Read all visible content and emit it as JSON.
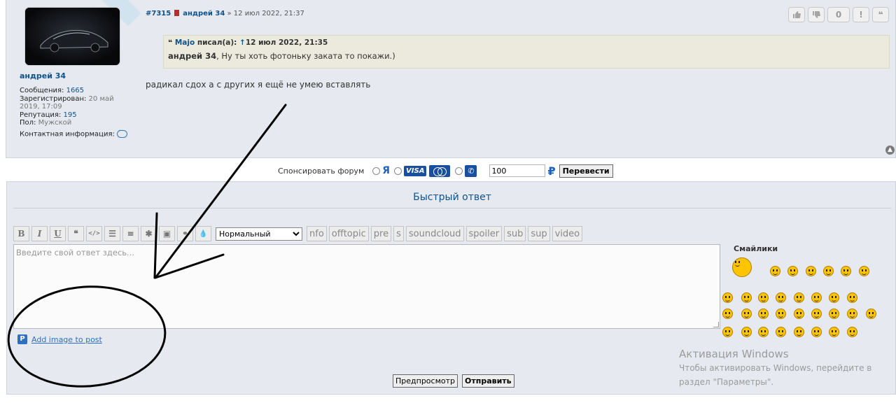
{
  "post": {
    "author": "андрей 34",
    "profile": {
      "messages_label": "Сообщения:",
      "messages": "1665",
      "registered_label": "Зарегистрирован:",
      "registered": "20 май",
      "registered2": "2019, 17:09",
      "reputation_label": "Репутация:",
      "reputation": "195",
      "gender_label": "Пол:",
      "gender": "Мужской",
      "contact_label": "Контактная информация:"
    },
    "number": "#7315",
    "header_author": "андрей 34",
    "separator": "»",
    "date": "12 июл 2022, 21:37",
    "quote": {
      "author": "Majo",
      "wrote": "писал(а):",
      "arrow": "↑",
      "date": "12 июл 2022, 21:35",
      "mention": "андрей 34",
      "text": ", Ну ты хоть фотоньку заката то покажи.)"
    },
    "text": "радикал сдох а с других я ещё не умею вставлять",
    "vote_count": "0",
    "report": "!",
    "quote_btn": "❝"
  },
  "sponsor": {
    "label": "Спонсировать форум",
    "ya": "Я",
    "visa": "VISA",
    "amount": "100",
    "currency": "₽",
    "submit": "Перевести"
  },
  "quick_reply": {
    "title": "Быстрый ответ",
    "toolbar": {
      "bold": "B",
      "italic": "I",
      "underline": "U",
      "quote": "❝",
      "code": "</>",
      "list": "☰",
      "olist": "≡",
      "star": "✱",
      "img": "▣",
      "link": "🔗",
      "color": "●",
      "font_size": "Нормальный",
      "tags": [
        "nfo",
        "offtopic",
        "pre",
        "s",
        "soundcloud",
        "spoiler",
        "sub",
        "sup",
        "video"
      ]
    },
    "placeholder": "Введите свой ответ здесь...",
    "add_image_icon": "P",
    "add_image": "Add image to post",
    "preview": "Предпросмотр",
    "submit": "Отправить",
    "smileys_title": "Смайлики"
  },
  "watermark": {
    "title": "Активация Windows",
    "line1": "Чтобы активировать Windows, перейдите в",
    "line2": "раздел \"Параметры\"."
  },
  "colors": {
    "link": "#105289",
    "panel": "#e6e9ef",
    "quote_bg": "#ebeadd"
  }
}
